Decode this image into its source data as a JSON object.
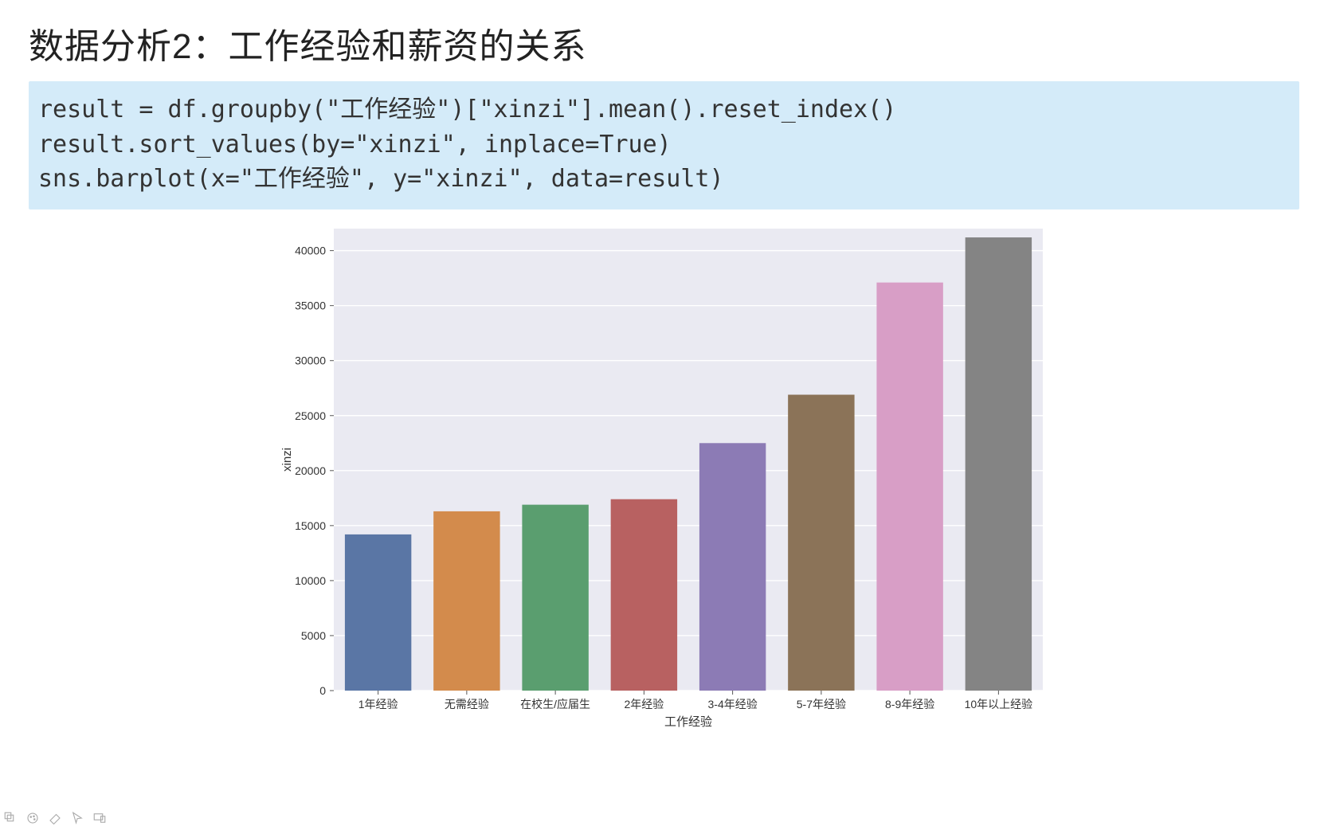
{
  "title": "数据分析2：工作经验和薪资的关系",
  "code": "result = df.groupby(\"工作经验\")[\"xinzi\"].mean().reset_index()\nresult.sort_values(by=\"xinzi\", inplace=True)\nsns.barplot(x=\"工作经验\", y=\"xinzi\", data=result)",
  "chart_data": {
    "type": "bar",
    "categories": [
      "1年经验",
      "无需经验",
      "在校生/应届生",
      "2年经验",
      "3-4年经验",
      "5-7年经验",
      "8-9年经验",
      "10年以上经验"
    ],
    "values": [
      14200,
      16300,
      16900,
      17400,
      22500,
      26900,
      37100,
      41200
    ],
    "colors": [
      "#5a76a5",
      "#d38b4c",
      "#5a9e6f",
      "#b86161",
      "#8c7bb5",
      "#8b7358",
      "#d89ec6",
      "#848484"
    ],
    "title": "",
    "xlabel": "工作经验",
    "ylabel": "xinzi",
    "ylim": [
      0,
      42000
    ],
    "yticks": [
      0,
      5000,
      10000,
      15000,
      20000,
      25000,
      30000,
      35000,
      40000
    ]
  },
  "footer_icons": [
    "layers-icon",
    "palette-icon",
    "eraser-icon",
    "cursor-icon",
    "devices-icon"
  ]
}
